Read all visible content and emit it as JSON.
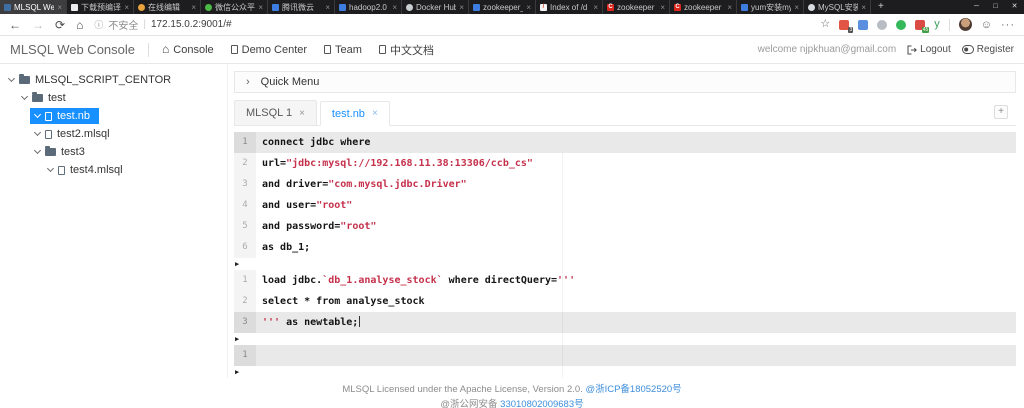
{
  "colors": {
    "accent": "#1890ff",
    "string_red": "#c5304b",
    "footer_link": "#3d8edb",
    "selected_bg": "#1890ff"
  },
  "browser": {
    "tab_strip": {
      "close_glyph": "×",
      "new_tab_glyph": "+",
      "tabs": [
        {
          "label": "MLSQL Web",
          "active": true,
          "favicon": {
            "shape": "sq",
            "color": "#3e6fa0"
          }
        },
        {
          "label": "下载预编译",
          "favicon": {
            "shape": "sq",
            "color": "#ececec"
          }
        },
        {
          "label": "在线编辑",
          "favicon": {
            "shape": "circ",
            "color": "#e8a33d"
          }
        },
        {
          "label": "微信公众平",
          "favicon": {
            "shape": "circ",
            "color": "#4cba46"
          }
        },
        {
          "label": "腾讯微云",
          "favicon": {
            "shape": "sq",
            "color": "#3d7de0"
          }
        },
        {
          "label": "hadoop2.0",
          "favicon": {
            "shape": "sq",
            "color": "#3d7de0"
          }
        },
        {
          "label": "Docker Hub",
          "favicon": {
            "shape": "circ",
            "color": "#c9ced2"
          }
        },
        {
          "label": "zookeeper_",
          "favicon": {
            "shape": "sq",
            "color": "#3d7de0"
          }
        },
        {
          "label": "Index of /d",
          "favicon": {
            "shape": "sq",
            "color": "#f5f5f5",
            "glyph": "/",
            "glyph_color": "#d9442c"
          }
        },
        {
          "label": "zookeeper",
          "favicon": {
            "shape": "sq",
            "color": "#d9251c",
            "glyph": "C",
            "glyph_color": "#ffffff"
          }
        },
        {
          "label": "zookeeper",
          "favicon": {
            "shape": "sq",
            "color": "#d9251c",
            "glyph": "C",
            "glyph_color": "#ffffff"
          }
        },
        {
          "label": "yum安装my",
          "favicon": {
            "shape": "sq",
            "color": "#3d7de0"
          }
        },
        {
          "label": "MySQL安装",
          "favicon": {
            "shape": "circ",
            "color": "#d8dde2"
          }
        }
      ],
      "window_controls": [
        {
          "name": "minimize-button",
          "glyph": "─"
        },
        {
          "name": "maximize-button",
          "glyph": "□"
        },
        {
          "name": "close-button",
          "glyph": "✕"
        }
      ]
    },
    "toolbar": {
      "back_glyph": "←",
      "forward_glyph": "→",
      "refresh_glyph": "⟳",
      "home_glyph": "⌂",
      "address": {
        "info_glyph": "ⓘ",
        "security": "不安全",
        "divider": "|",
        "url": "172.15.0.2:9001/#"
      },
      "right_icons": [
        {
          "name": "favorites-star-icon",
          "type": "glyph",
          "glyph": "☆",
          "color": "#5f6368"
        },
        {
          "name": "red-extension-icon",
          "type": "sq",
          "color": "#e25544",
          "badge": "3",
          "badge_color": "#555555"
        },
        {
          "name": "blue-extension-icon",
          "type": "sq",
          "color": "#5a8fe0"
        },
        {
          "name": "gray-extension-icon",
          "type": "circ",
          "color": "#b7bdc2"
        },
        {
          "name": "evernote-extension-icon",
          "type": "circ",
          "color": "#35b85a"
        },
        {
          "name": "red45-extension-icon",
          "type": "sq",
          "color": "#d94b43",
          "badge": "45",
          "badge_color": "#43a047"
        },
        {
          "name": "y-extension-icon",
          "type": "glyph",
          "glyph": "y",
          "color": "#3da05f"
        }
      ],
      "smiley_glyph": "☺",
      "more_glyph": "···"
    }
  },
  "header": {
    "title": "MLSQL Web Console",
    "nav": [
      {
        "label": "Console",
        "icon": "home"
      },
      {
        "label": "Demo Center",
        "icon": "page"
      },
      {
        "label": "Team",
        "icon": "page"
      },
      {
        "label": "中文文档",
        "icon": "page"
      }
    ],
    "welcome": "welcome njpkhuan@gmail.com",
    "logout": "Logout",
    "register": "Register"
  },
  "sidebar": {
    "tree": [
      {
        "label": "MLSQL_SCRIPT_CENTOR",
        "type": "folder",
        "level": 0
      },
      {
        "label": "test",
        "type": "folder",
        "level": 1
      },
      {
        "label": "test.nb",
        "type": "file",
        "level": 2,
        "selected": true
      },
      {
        "label": "test2.mlsql",
        "type": "file",
        "level": 2
      },
      {
        "label": "test3",
        "type": "folder",
        "level": 2
      },
      {
        "label": "test4.mlsql",
        "type": "file",
        "level": 3
      }
    ]
  },
  "main": {
    "quick_menu": {
      "chevron": "›",
      "label": "Quick Menu"
    },
    "tabs": [
      {
        "label": "MLSQL 1",
        "close": "×"
      },
      {
        "label": "test.nb",
        "close": "×",
        "active": true
      }
    ],
    "add_tab_glyph": "+",
    "editor": {
      "run_glyph": "▶",
      "cells": [
        {
          "lines": [
            {
              "n": "1",
              "active": true,
              "seg": [
                [
                  "p",
                  "connect jdbc where"
                ]
              ]
            },
            {
              "n": "2",
              "seg": [
                [
                  "p",
                  "url="
                ],
                [
                  "s",
                  "\"jdbc:mysql://192.168.11.38:13306/ccb_cs\""
                ]
              ]
            },
            {
              "n": "3",
              "seg": [
                [
                  "p",
                  "and driver="
                ],
                [
                  "s",
                  "\"com.mysql.jdbc.Driver\""
                ]
              ]
            },
            {
              "n": "4",
              "seg": [
                [
                  "p",
                  "and user="
                ],
                [
                  "s",
                  "\"root\""
                ]
              ]
            },
            {
              "n": "5",
              "seg": [
                [
                  "p",
                  "and password="
                ],
                [
                  "s",
                  "\"root\""
                ]
              ]
            },
            {
              "n": "6",
              "seg": [
                [
                  "p",
                  "as db_1;"
                ]
              ]
            }
          ]
        },
        {
          "lines": [
            {
              "n": "1",
              "seg": [
                [
                  "p",
                  "load jdbc."
                ],
                [
                  "s",
                  "`db_1.analyse_stock`"
                ],
                [
                  "p",
                  " where directQuery="
                ],
                [
                  "s",
                  "'''"
                ]
              ]
            },
            {
              "n": "2",
              "seg": [
                [
                  "p",
                  "select * from analyse_stock"
                ]
              ]
            },
            {
              "n": "3",
              "active": true,
              "cursor": true,
              "seg": [
                [
                  "s",
                  "'''"
                ],
                [
                  "p",
                  " as newtable;"
                ]
              ]
            }
          ]
        },
        {
          "lines": [
            {
              "n": "1",
              "active": true,
              "seg": []
            }
          ]
        }
      ]
    }
  },
  "footer": {
    "line1_text": "MLSQL Licensed under the Apache License, Version 2.0. ",
    "line1_link": "@浙ICP备18052520号",
    "line2_prefix": "@浙公网安备 ",
    "line2_link": "33010802009683号"
  }
}
